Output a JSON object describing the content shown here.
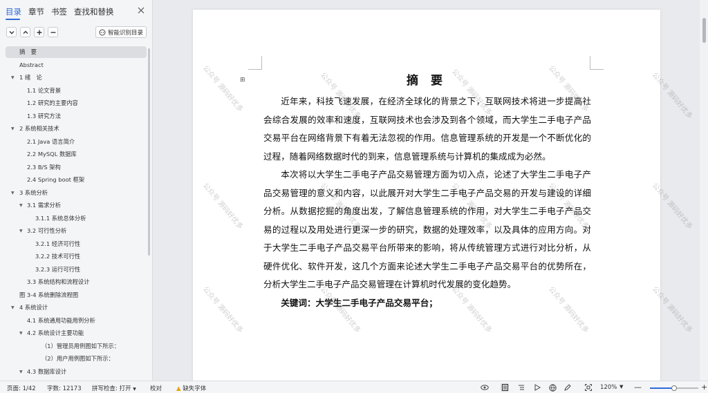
{
  "sidebar": {
    "tabs": [
      {
        "label": "目录"
      },
      {
        "label": "章节"
      },
      {
        "label": "书签"
      },
      {
        "label": "查找和替换"
      }
    ],
    "smart_button": "智能识别目录",
    "toc": [
      {
        "label": "摘　要",
        "level": 0,
        "arrow": false,
        "selected": true
      },
      {
        "label": "Abstract",
        "level": 0,
        "arrow": false
      },
      {
        "label": "1  绪　论",
        "level": 0,
        "arrow": true
      },
      {
        "label": "1.1 论文背景",
        "level": 1,
        "arrow": false
      },
      {
        "label": "1.2  研究的主要内容",
        "level": 1,
        "arrow": false
      },
      {
        "label": "1.3  研究方法",
        "level": 1,
        "arrow": false
      },
      {
        "label": "2 系统相关技术",
        "level": 0,
        "arrow": true
      },
      {
        "label": "2.1 Java 语言简介",
        "level": 1,
        "arrow": false
      },
      {
        "label": "2.2    MySQL 数据库",
        "level": 1,
        "arrow": false
      },
      {
        "label": "2.3 B/S 架构",
        "level": 1,
        "arrow": false
      },
      {
        "label": "2.4 Spring boot 框架",
        "level": 1,
        "arrow": false
      },
      {
        "label": "3  系统分析",
        "level": 0,
        "arrow": true
      },
      {
        "label": "3.1  需求分析",
        "level": 1,
        "arrow": true
      },
      {
        "label": "3.1.1 系统总体分析",
        "level": 2,
        "arrow": false
      },
      {
        "label": "3.2  可行性分析",
        "level": 1,
        "arrow": true
      },
      {
        "label": "3.2.1  经济可行性",
        "level": 2,
        "arrow": false
      },
      {
        "label": "3.2.2  技术可行性",
        "level": 2,
        "arrow": false
      },
      {
        "label": "3.2.3  运行可行性",
        "level": 2,
        "arrow": false
      },
      {
        "label": "3.3    系统结构和流程设计",
        "level": 1,
        "arrow": false
      },
      {
        "label": "图 3-4 系统删除流程图",
        "level": 0,
        "arrow": false
      },
      {
        "label": "4  系统设计",
        "level": 0,
        "arrow": true
      },
      {
        "label": "4.1 系统通用功能用例分析",
        "level": 1,
        "arrow": false
      },
      {
        "label": "4.2  系统设计主要功能",
        "level": 1,
        "arrow": true
      },
      {
        "label": "（1）管理员用例图如下所示：",
        "level": 3,
        "arrow": false
      },
      {
        "label": "（2）用户用例图如下所示：",
        "level": 3,
        "arrow": false
      },
      {
        "label": "4.3  数据库设计",
        "level": 1,
        "arrow": true
      }
    ]
  },
  "document": {
    "title": "摘  要",
    "paragraphs": [
      "近年来，科技飞速发展，在经济全球化的背景之下，互联网技术将进一步提高社会综合发展的效率和速度，互联网技术也会涉及到各个领域，而大学生二手电子产品交易平台在网络背景下有着无法忽视的作用。信息管理系统的开发是一个不断优化的过程，随着网络数据时代的到来，信息管理系统与计算机的集成成为必然。",
      "本次将以大学生二手电子产品交易管理方面为切入点，论述了大学生二手电子产品交易管理的意义和内容，以此展开对大学生二手电子产品交易的开发与建设的详细分析。从数据挖掘的角度出发，了解信息管理系统的作用，对大学生二手电子产品交易的过程以及用处进行更深一步的研究，数据的处理效率，以及具体的应用方向。对于大学生二手电子产品交易平台所带来的影响，将从传统管理方式进行对比分析，从硬件优化、软件开发，这几个方面来论述大学生二手电子产品交易平台的优势所在，分析大学生二手电子产品交易管理在计算机时代发展的变化趋势。"
    ],
    "keywords": "关键词：大学生二手电子产品交易平台；",
    "watermark": "公众号 源码好优多"
  },
  "status": {
    "page": "页面: 1/42",
    "words": "字数: 12173",
    "spellcheck": "拼写检查: 打开",
    "proof": "校对",
    "missing_font": "缺失字体",
    "zoom": "120%",
    "zoom_level": 0.5
  },
  "colors": {
    "accent": "#2e6ad8",
    "warning": "#e8a200"
  }
}
